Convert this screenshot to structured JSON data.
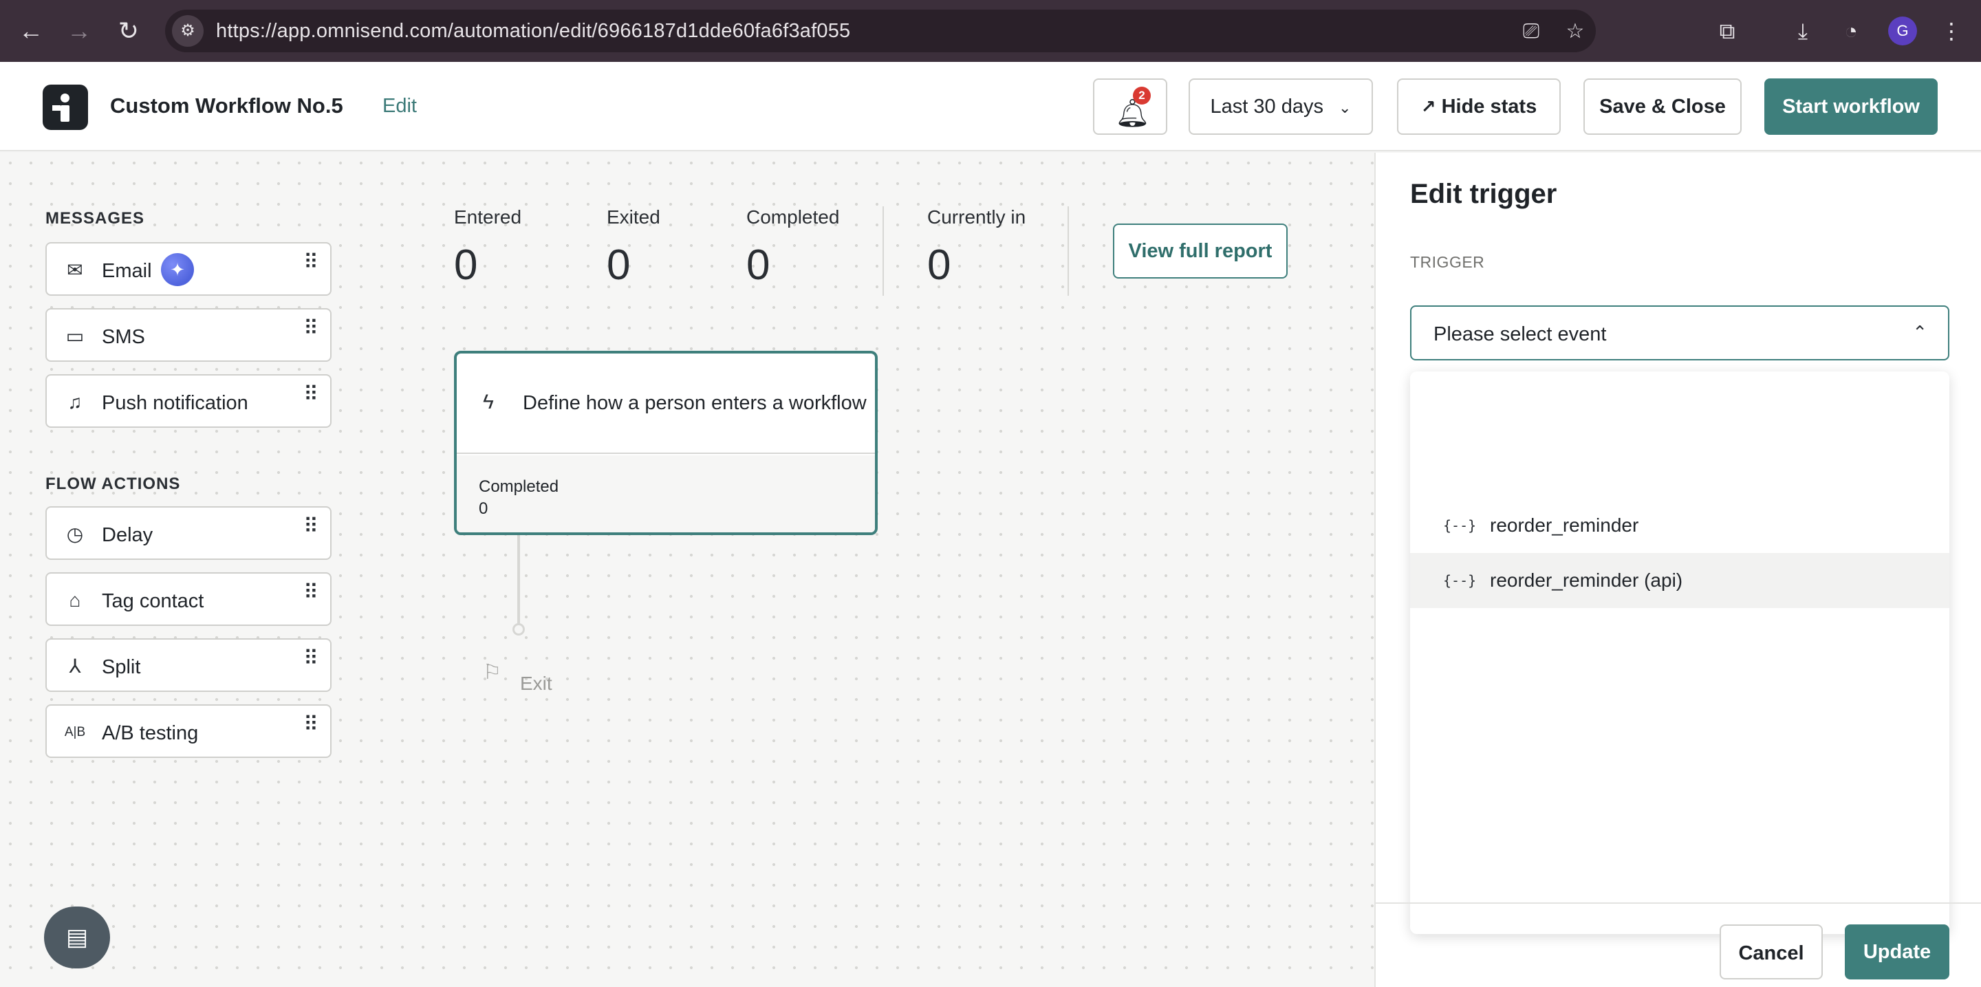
{
  "browser": {
    "url": "https://app.omnisend.com/automation/edit/6966187d1dde60fa6f3af055",
    "profile_initial": "G",
    "icons": [
      "back-arrow-icon",
      "forward-arrow-icon",
      "reload-icon",
      "site-settings-icon",
      "install-app-icon",
      "star-icon",
      "extensions-icon",
      "download-icon",
      "performance-icon",
      "menu-dots-icon"
    ]
  },
  "header": {
    "title": "Custom Workflow No.5",
    "edit_label": "Edit",
    "notification_count": "2",
    "date_range": "Last 30 days",
    "hide_stats_label": "Hide stats",
    "save_close_label": "Save & Close",
    "start_label": "Start workflow"
  },
  "sidebar": {
    "messages_title": "MESSAGES",
    "messages": [
      {
        "label": "Email",
        "icon": "mail-icon"
      },
      {
        "label": "SMS",
        "icon": "chat-bubble-icon"
      },
      {
        "label": "Push notification",
        "icon": "bell-icon"
      }
    ],
    "flow_title": "FLOW ACTIONS",
    "flow_actions": [
      {
        "label": "Delay",
        "icon": "clock-icon"
      },
      {
        "label": "Tag contact",
        "icon": "tag-icon"
      },
      {
        "label": "Split",
        "icon": "split-icon"
      },
      {
        "label": "A/B testing",
        "icon": "ab-icon",
        "icon_text": "A|B"
      }
    ]
  },
  "stats": {
    "items": [
      {
        "label": "Entered",
        "value": "0"
      },
      {
        "label": "Exited",
        "value": "0"
      },
      {
        "label": "Completed",
        "value": "0"
      },
      {
        "label": "Currently in",
        "value": "0"
      }
    ],
    "report_label": "View full report"
  },
  "trigger_card": {
    "text": "Define how a person enters a workflow",
    "completed_label": "Completed",
    "completed_value": "0"
  },
  "exit_label": "Exit",
  "panel": {
    "title": "Edit trigger",
    "trigger_label": "TRIGGER",
    "select_placeholder": "Please select event",
    "options": [
      {
        "label": "reorder_reminder",
        "icon": "{--}"
      },
      {
        "label": "reorder_reminder (api)",
        "icon": "{--}"
      }
    ],
    "cancel_label": "Cancel",
    "update_label": "Update"
  },
  "colors": {
    "accent": "#3e7f7c",
    "badge": "#d93a32",
    "chrome_bg": "#3c2f3b"
  }
}
